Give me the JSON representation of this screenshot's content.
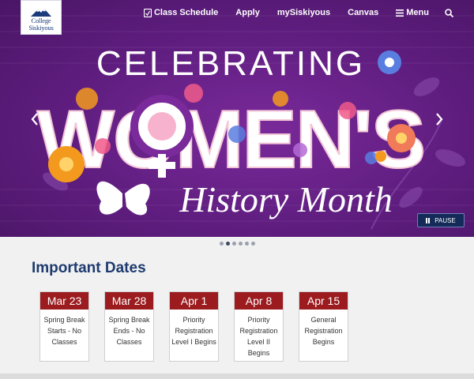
{
  "logo": {
    "line1": "College",
    "line2": "Siskiyous"
  },
  "nav": {
    "items": [
      {
        "label": "Class Schedule",
        "icon": "document-icon"
      },
      {
        "label": "Apply",
        "icon": null
      },
      {
        "label": "mySiskiyous",
        "icon": null
      },
      {
        "label": "Canvas",
        "icon": null
      },
      {
        "label": "Menu",
        "icon": "hamburger-icon"
      }
    ],
    "search_icon": "search-icon"
  },
  "hero": {
    "line1": "CELEBRATING",
    "line2": "WOMEN'S",
    "line3": "History Month",
    "pause_label": "PAUSE",
    "slide_count": 6,
    "active_slide": 2,
    "colors": {
      "background": "#5e1d7e",
      "accent_orange": "#f39a1e",
      "accent_pink": "#f05a8a",
      "accent_blue": "#5a7de0"
    }
  },
  "dates": {
    "title": "Important Dates",
    "cards": [
      {
        "date": "Mar 23",
        "desc": "Spring Break Starts - No Classes"
      },
      {
        "date": "Mar 28",
        "desc": "Spring Break Ends - No Classes"
      },
      {
        "date": "Apr 1",
        "desc": "Priority Registration Level I Begins"
      },
      {
        "date": "Apr 8",
        "desc": "Priority Registration Level II Begins"
      },
      {
        "date": "Apr 15",
        "desc": "General Registration Begins"
      }
    ],
    "card_color": "#9b1b1f"
  }
}
